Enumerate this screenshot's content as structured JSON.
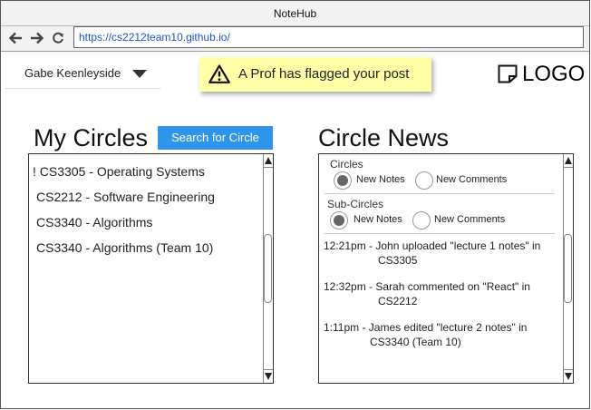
{
  "window": {
    "title": "NoteHub"
  },
  "browser": {
    "url": "https://cs2212team10.github.io/"
  },
  "user": {
    "name": "Gabe Keenleyside"
  },
  "notification": {
    "text": "A Prof has flagged your post"
  },
  "logo": {
    "text": "LOGO"
  },
  "my_circles": {
    "title": "My Circles",
    "search_button": "Search for Circle",
    "items": [
      {
        "label": "! CS3305 - Operating Systems"
      },
      {
        "label": "CS2212 - Software Engineering"
      },
      {
        "label": "CS3340 - Algorithms"
      },
      {
        "label": "CS3340 - Algorithms (Team 10)"
      }
    ]
  },
  "circle_news": {
    "title": "Circle News",
    "filters": {
      "circles": {
        "label": "Circles",
        "options": [
          {
            "label": "New Notes",
            "selected": true
          },
          {
            "label": "New Comments",
            "selected": false
          }
        ]
      },
      "sub_circles": {
        "label": "Sub-Circles",
        "options": [
          {
            "label": "New Notes",
            "selected": true
          },
          {
            "label": "New Comments",
            "selected": false
          }
        ]
      }
    },
    "items": [
      {
        "line1": "12:21pm - John uploaded \"lecture 1 notes\" in",
        "line2": "CS3305"
      },
      {
        "line1": "12:32pm - Sarah commented on \"React\" in",
        "line2": "CS2212"
      },
      {
        "line1": "1:11pm - James edited \"lecture 2 notes\" in",
        "line2": "CS3340 (Team 10)"
      }
    ]
  }
}
